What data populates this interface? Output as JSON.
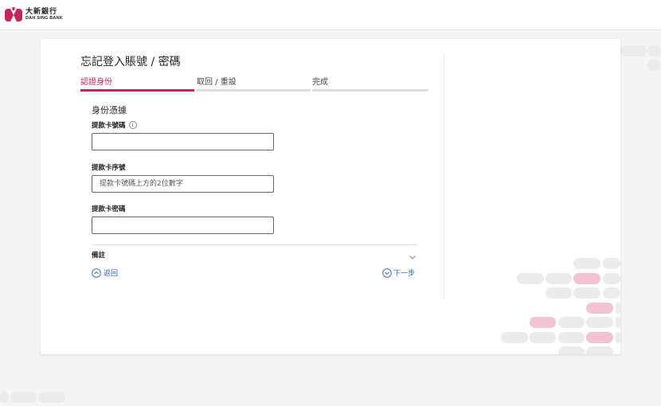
{
  "brand": {
    "name_cn": "大新銀行",
    "name_en": "DAH SING BANK",
    "color": "#c8265a"
  },
  "page": {
    "title": "忘記登入賬號 / 密碼"
  },
  "steps": [
    {
      "label": "認證身份",
      "active": true
    },
    {
      "label": "取回 / 重設",
      "active": false
    },
    {
      "label": "完成",
      "active": false
    }
  ],
  "form": {
    "section_title": "身份憑據",
    "card_number": {
      "label": "提款卡號碼",
      "value": "",
      "placeholder": ""
    },
    "card_sequence": {
      "label": "提款卡序號",
      "value": "",
      "placeholder": "提款卡號碼上方的2位數字"
    },
    "card_pin": {
      "label": "提款卡密碼",
      "value": "",
      "placeholder": ""
    }
  },
  "remarks": {
    "label": "備註"
  },
  "nav": {
    "back_label": "返回",
    "next_label": "下一步"
  },
  "icons": {
    "info": "info-icon",
    "remark_toggle": "chevron-down-icon",
    "back": "chevron-up-circle-icon",
    "next": "chevron-down-circle-icon"
  }
}
